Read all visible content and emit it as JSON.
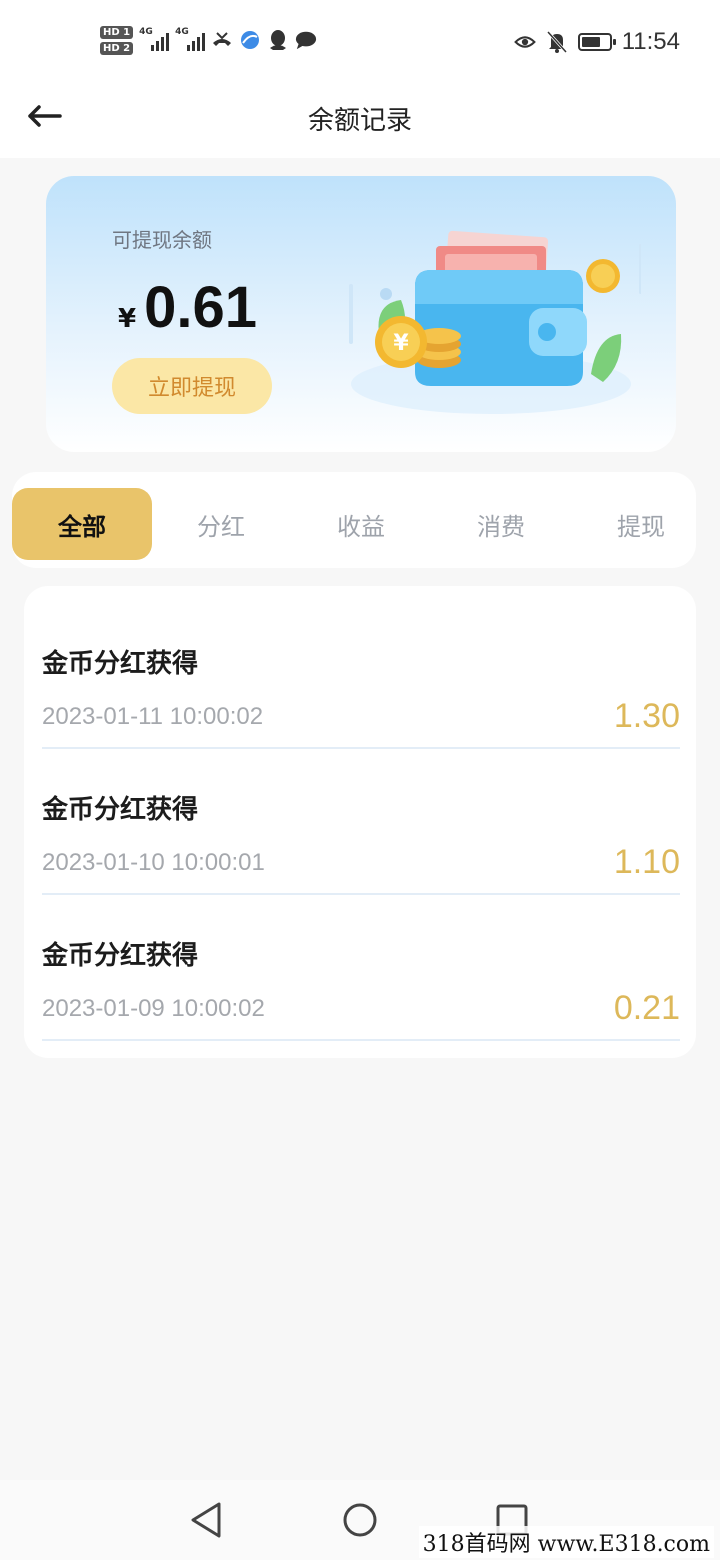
{
  "status_bar": {
    "hd1": "HD 1",
    "hd2": "HD 2",
    "net1": "4G",
    "net2": "4G",
    "time": "11:54",
    "icons": [
      "signal-icon",
      "missed-call-icon",
      "browser-icon",
      "qq-icon",
      "chat-bubble-icon",
      "eye-icon",
      "mute-bell-icon",
      "battery-icon"
    ]
  },
  "header": {
    "title": "余额记录",
    "back_icon": "arrow-left-icon"
  },
  "balance": {
    "label": "可提现余额",
    "currency": "¥",
    "amount": "0.61",
    "withdraw_label": "立即提现",
    "illustration": "wallet-icon"
  },
  "tabs": [
    {
      "label": "全部",
      "active": true
    },
    {
      "label": "分红",
      "active": false
    },
    {
      "label": "收益",
      "active": false
    },
    {
      "label": "消费",
      "active": false
    },
    {
      "label": "提现",
      "active": false
    }
  ],
  "records": [
    {
      "title": "金币分红获得",
      "time": "2023-01-11 10:00:02",
      "amount": "1.30"
    },
    {
      "title": "金币分红获得",
      "time": "2023-01-10 10:00:01",
      "amount": "1.10"
    },
    {
      "title": "金币分红获得",
      "time": "2023-01-09 10:00:02",
      "amount": "0.21"
    }
  ],
  "nav_bar": {
    "icons": [
      "back-triangle-icon",
      "home-circle-icon",
      "recents-square-icon"
    ]
  },
  "watermark": "318首码网 www.E318.com",
  "colors": {
    "accent_gold": "#e9c46a",
    "amount_gold": "#ddb85a",
    "button_bg": "#fbe7a6",
    "button_text": "#d18a2e"
  }
}
